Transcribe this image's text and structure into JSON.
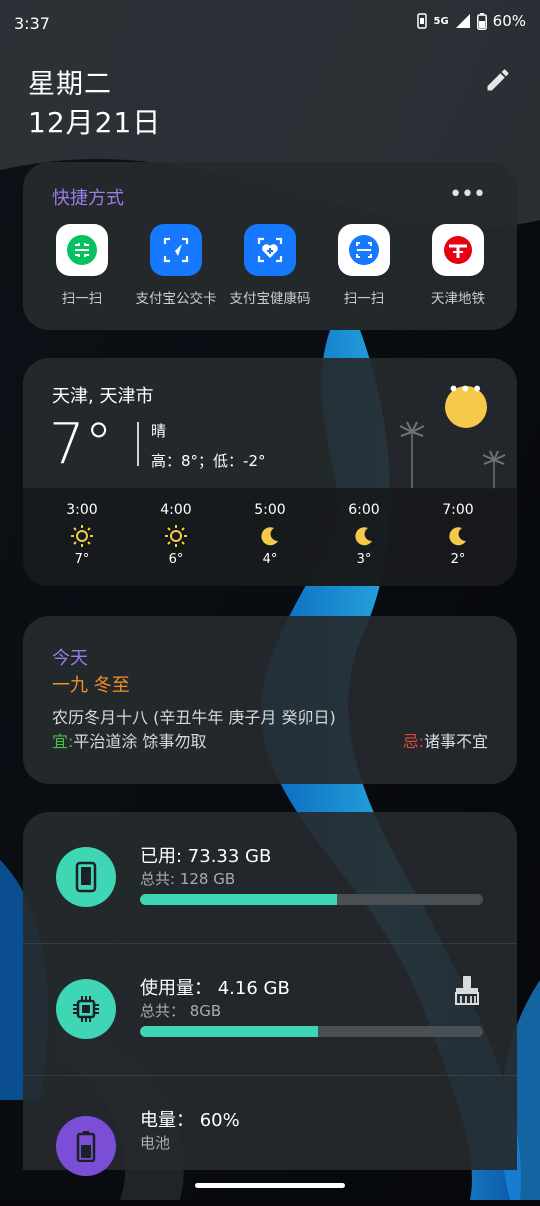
{
  "status_bar": {
    "time": "3:37",
    "network": "5G",
    "battery": "60%"
  },
  "header": {
    "weekday": "星期二",
    "date": "12月21日"
  },
  "shortcuts": {
    "title": "快捷方式",
    "items": [
      {
        "label": "扫一扫",
        "icon": "wechat-scan-icon",
        "bg": "#ffffff"
      },
      {
        "label": "支付宝公交卡",
        "icon": "alipay-bus-icon",
        "bg": "#1677ff"
      },
      {
        "label": "支付宝健康码",
        "icon": "alipay-health-icon",
        "bg": "#1677ff"
      },
      {
        "label": "扫一扫",
        "icon": "alipay-scan-icon",
        "bg": "#ffffff"
      },
      {
        "label": "天津地铁",
        "icon": "tianjin-metro-icon",
        "bg": "#ffffff"
      }
    ]
  },
  "weather": {
    "city": "天津, 天津市",
    "temp": "7°",
    "condition": "晴",
    "hilo": "高：8°；低：-2°",
    "hourly": [
      {
        "time": "3:00",
        "icon": "sun-icon",
        "temp": "7°"
      },
      {
        "time": "4:00",
        "icon": "sun-icon",
        "temp": "6°"
      },
      {
        "time": "5:00",
        "icon": "moon-icon",
        "temp": "4°"
      },
      {
        "time": "6:00",
        "icon": "moon-icon",
        "temp": "3°"
      },
      {
        "time": "7:00",
        "icon": "moon-icon",
        "temp": "2°"
      }
    ]
  },
  "calendar": {
    "today": "今天",
    "term": "一九 冬至",
    "lunar": "农历冬月十八 (辛丑牛年 庚子月 癸卯日)",
    "yi_label": "宜:",
    "yi": "平治道涂 馀事勿取",
    "ji_label": "忌:",
    "ji": "诸事不宜"
  },
  "device": {
    "storage": {
      "title": "已用: 73.33 GB",
      "sub": "总共: 128 GB",
      "fraction": 0.573
    },
    "memory": {
      "title": "使用量： 4.16 GB",
      "sub": "总共：  8GB",
      "fraction": 0.52
    },
    "battery": {
      "title": "电量： 60%",
      "sub": "电池"
    }
  },
  "colors": {
    "accent_purple": "#9b7be8",
    "accent_teal": "#3fd6b5",
    "term_orange": "#f0902a"
  }
}
